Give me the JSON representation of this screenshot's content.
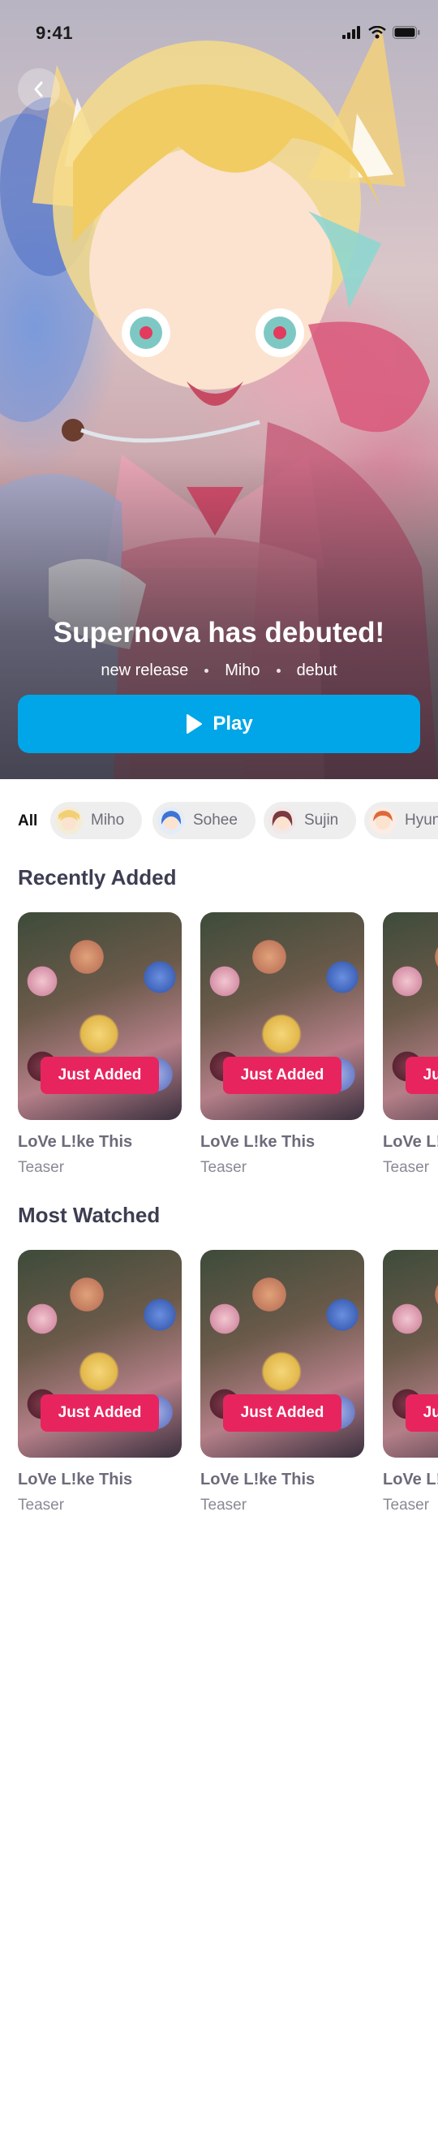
{
  "status": {
    "time": "9:41"
  },
  "hero": {
    "title": "Supernova has debuted!",
    "tags": [
      "new release",
      "Miho",
      "debut"
    ],
    "play_label": "Play"
  },
  "filters": {
    "all_label": "All",
    "chips": [
      {
        "label": "Miho",
        "avatar_color": "#f2cf72"
      },
      {
        "label": "Sohee",
        "avatar_color": "#3e74d6"
      },
      {
        "label": "Sujin",
        "avatar_color": "#7b3a3f"
      },
      {
        "label": "Hyun",
        "avatar_color": "#e0683a"
      }
    ]
  },
  "sections": [
    {
      "title": "Recently Added",
      "cards": [
        {
          "badge": "Just Added",
          "title": "LoVe L!ke This",
          "subtitle": "Teaser"
        },
        {
          "badge": "Just Added",
          "title": "LoVe L!ke This",
          "subtitle": "Teaser"
        },
        {
          "badge": "Just Added",
          "title": "LoVe L!ke This",
          "subtitle": "Teaser"
        }
      ]
    },
    {
      "title": "Most Watched",
      "cards": [
        {
          "badge": "Just Added",
          "title": "LoVe L!ke This",
          "subtitle": "Teaser"
        },
        {
          "badge": "Just Added",
          "title": "LoVe L!ke This",
          "subtitle": "Teaser"
        },
        {
          "badge": "Just Added",
          "title": "LoVe L!ke This",
          "subtitle": "Teaser"
        }
      ]
    }
  ],
  "colors": {
    "accent": "#00a6e8",
    "badge": "#e8245e",
    "heading": "#3d3d52"
  },
  "icons": {
    "back": "chevron-left-icon",
    "play": "play-icon",
    "signal": "signal-icon",
    "wifi": "wifi-icon",
    "battery": "battery-icon"
  }
}
